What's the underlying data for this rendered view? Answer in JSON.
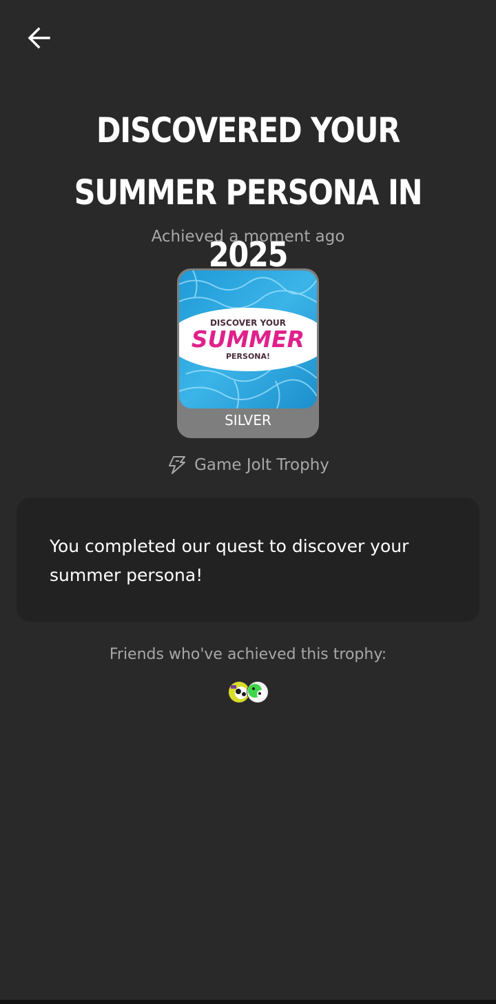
{
  "header": {
    "back_icon": "arrow-left-icon"
  },
  "trophy": {
    "title": "DISCOVERED YOUR SUMMER PERSONA IN 2025",
    "achieved_text": "Achieved a moment ago",
    "badge": {
      "line1": "DISCOVER YOUR",
      "line2": "SUMMER",
      "line3": "PERSONA!"
    },
    "tier": "SILVER",
    "source_icon": "game-jolt-icon",
    "source_label": "Game Jolt Trophy",
    "description": "You completed our quest to discover your summer persona!"
  },
  "friends": {
    "label": "Friends who've achieved this trophy:",
    "avatars": [
      "friend-avatar-1",
      "friend-avatar-2"
    ]
  },
  "colors": {
    "background": "#292929",
    "card": "#212221",
    "tier_silver": "#7e7e7e",
    "muted_text": "#a8a8a8",
    "water": "#2aa3dc",
    "pink": "#e0218a"
  }
}
